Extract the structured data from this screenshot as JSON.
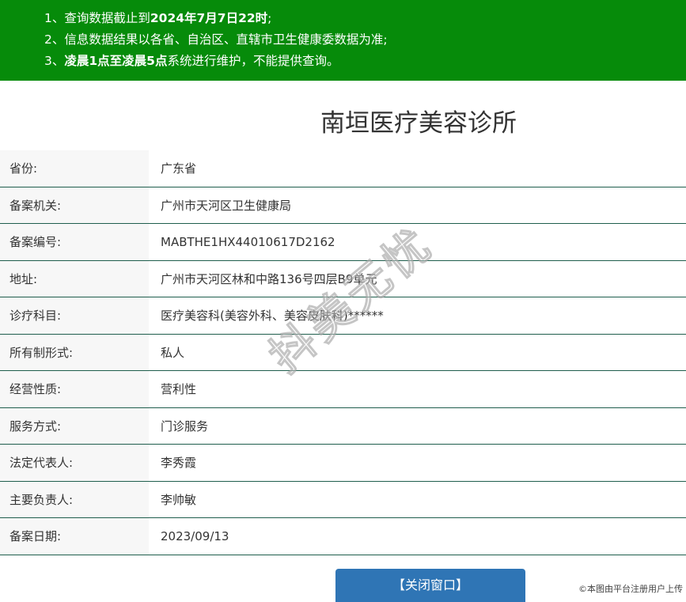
{
  "notice": {
    "line1": {
      "prefix": "1、查询数据截止到",
      "bold": "2024年7月7日22时",
      "suffix": ";"
    },
    "line2": {
      "text": "2、信息数据结果以各省、自治区、直辖市卫生健康委数据为准;"
    },
    "line3": {
      "prefix": "3、",
      "bold": "凌晨1点至凌晨5点",
      "suffix": "系统进行维护，不能提供查询。"
    }
  },
  "title": "南垣医疗美容诊所",
  "rows": [
    {
      "label": "省份:",
      "value": "广东省"
    },
    {
      "label": "备案机关:",
      "value": "广州市天河区卫生健康局"
    },
    {
      "label": "备案编号:",
      "value": "MABTHE1HX44010617D2162"
    },
    {
      "label": "地址:",
      "value": "广州市天河区林和中路136号四层B9单元"
    },
    {
      "label": "诊疗科目:",
      "value": "医疗美容科(美容外科、美容皮肤科)******"
    },
    {
      "label": "所有制形式:",
      "value": "私人"
    },
    {
      "label": "经营性质:",
      "value": "营利性"
    },
    {
      "label": "服务方式:",
      "value": "门诊服务"
    },
    {
      "label": "法定代表人:",
      "value": "李秀霞"
    },
    {
      "label": "主要负责人:",
      "value": "李帅敏"
    },
    {
      "label": "备案日期:",
      "value": "2023/09/13"
    }
  ],
  "watermark": "抖美无忧",
  "close_button": "【关闭窗口】",
  "credit": "©本图由平台注册用户上传",
  "colors": {
    "banner": "#068b0a",
    "button": "#2f75b5",
    "row_border": "#1f5e4d"
  }
}
